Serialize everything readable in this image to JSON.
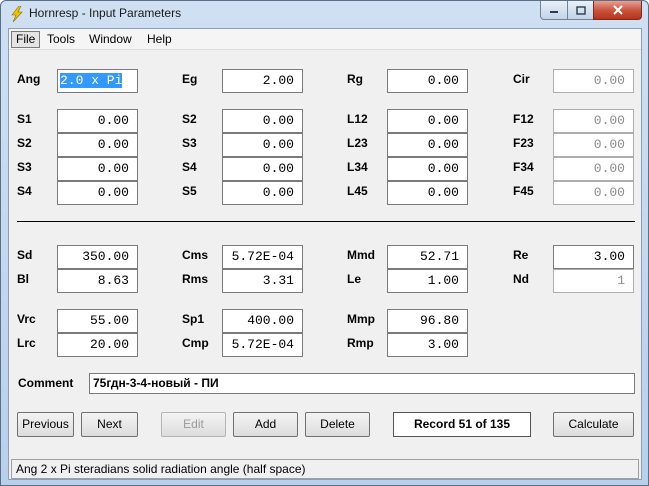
{
  "window": {
    "title": "Hornresp - Input Parameters"
  },
  "menu": [
    "File",
    "Tools",
    "Window",
    "Help"
  ],
  "top_fields": {
    "Ang": {
      "label": "Ang",
      "value": "2.0 x Pi"
    },
    "Eg": {
      "label": "Eg",
      "value": "2.00"
    },
    "Rg": {
      "label": "Rg",
      "value": "0.00"
    },
    "Cir": {
      "label": "Cir",
      "value": "0.00"
    }
  },
  "horn_rows": [
    {
      "c1": {
        "label": "S1",
        "value": "0.00"
      },
      "c2": {
        "label": "S2",
        "value": "0.00"
      },
      "c3": {
        "label": "L12",
        "value": "0.00"
      },
      "c4": {
        "label": "F12",
        "value": "0.00"
      }
    },
    {
      "c1": {
        "label": "S2",
        "value": "0.00"
      },
      "c2": {
        "label": "S3",
        "value": "0.00"
      },
      "c3": {
        "label": "L23",
        "value": "0.00"
      },
      "c4": {
        "label": "F23",
        "value": "0.00"
      }
    },
    {
      "c1": {
        "label": "S3",
        "value": "0.00"
      },
      "c2": {
        "label": "S4",
        "value": "0.00"
      },
      "c3": {
        "label": "L34",
        "value": "0.00"
      },
      "c4": {
        "label": "F34",
        "value": "0.00"
      }
    },
    {
      "c1": {
        "label": "S4",
        "value": "0.00"
      },
      "c2": {
        "label": "S5",
        "value": "0.00"
      },
      "c3": {
        "label": "L45",
        "value": "0.00"
      },
      "c4": {
        "label": "F45",
        "value": "0.00"
      }
    }
  ],
  "driver": {
    "Sd": {
      "label": "Sd",
      "value": "350.00"
    },
    "Cms": {
      "label": "Cms",
      "value": "5.72E-04"
    },
    "Mmd": {
      "label": "Mmd",
      "value": "52.71"
    },
    "Re": {
      "label": "Re",
      "value": "3.00"
    },
    "Bl": {
      "label": "Bl",
      "value": "8.63"
    },
    "Rms": {
      "label": "Rms",
      "value": "3.31"
    },
    "Le": {
      "label": "Le",
      "value": "1.00"
    },
    "Nd": {
      "label": "Nd",
      "value": "1"
    }
  },
  "chamber": {
    "Vrc": {
      "label": "Vrc",
      "value": "55.00"
    },
    "Sp1": {
      "label": "Sp1",
      "value": "400.00"
    },
    "Mmp": {
      "label": "Mmp",
      "value": "96.80"
    },
    "Lrc": {
      "label": "Lrc",
      "value": "20.00"
    },
    "Cmp": {
      "label": "Cmp",
      "value": "5.72E-04"
    },
    "Rmp": {
      "label": "Rmp",
      "value": "3.00"
    }
  },
  "comment": {
    "label": "Comment",
    "value": "75гдн-3-4-новый - ПИ"
  },
  "buttons": {
    "previous": "Previous",
    "next": "Next",
    "edit": "Edit",
    "add": "Add",
    "delete": "Delete",
    "calculate": "Calculate"
  },
  "record": "Record 51 of 135",
  "status": "Ang   2 x Pi steradians solid radiation angle  (half space)",
  "icons": [
    "lightning-icon",
    "minimize-icon",
    "maximize-icon",
    "close-icon"
  ],
  "colors": {
    "selection": "#3399ff",
    "close_button": "#c7513a",
    "title_bar": "#cfe0f2"
  }
}
